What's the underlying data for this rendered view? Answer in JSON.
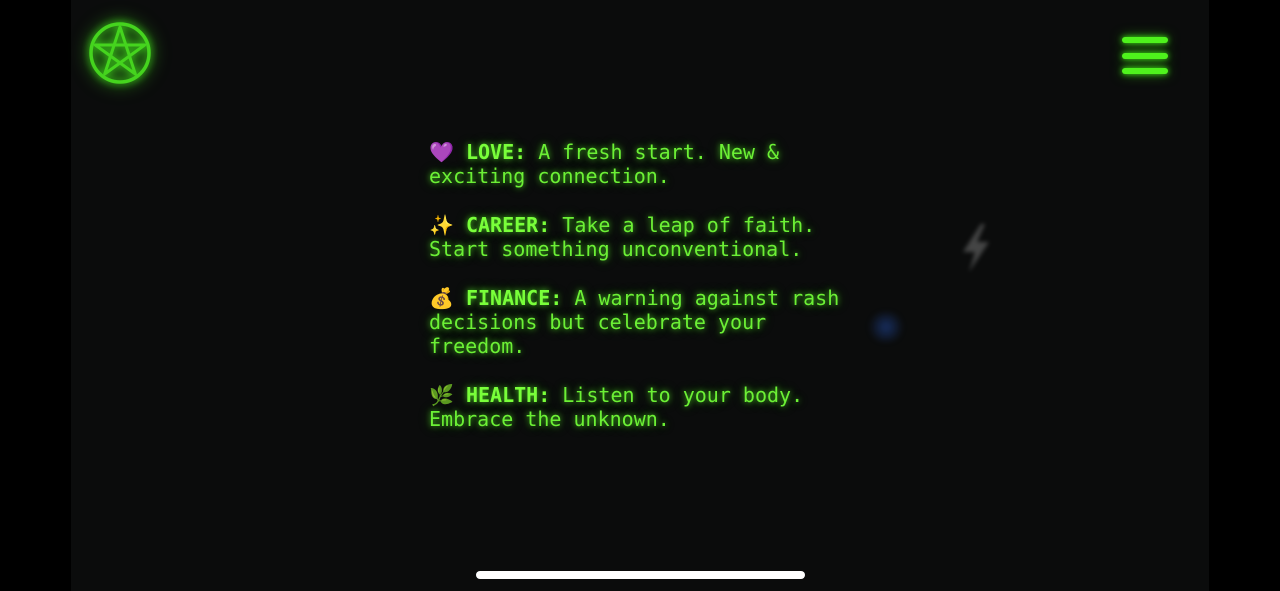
{
  "theme": {
    "accent": "#4ff21d",
    "text": "#6cf035",
    "background": "#0b0c0c"
  },
  "header": {
    "logo_icon": "pentagram-icon",
    "menu_icon": "hamburger-menu-icon"
  },
  "reading": {
    "entries": [
      {
        "emoji": "💜",
        "label": "LOVE:",
        "text": "A fresh start. New & exciting connection."
      },
      {
        "emoji": "✨",
        "label": "CAREER:",
        "text": "Take a leap of faith. Start something unconventional."
      },
      {
        "emoji": "💰",
        "label": "FINANCE:",
        "text": "A warning against rash decisions but celebrate your freedom."
      },
      {
        "emoji": "🌿",
        "label": "HEALTH:",
        "text": "Listen to your body. Embrace the unknown."
      }
    ]
  }
}
